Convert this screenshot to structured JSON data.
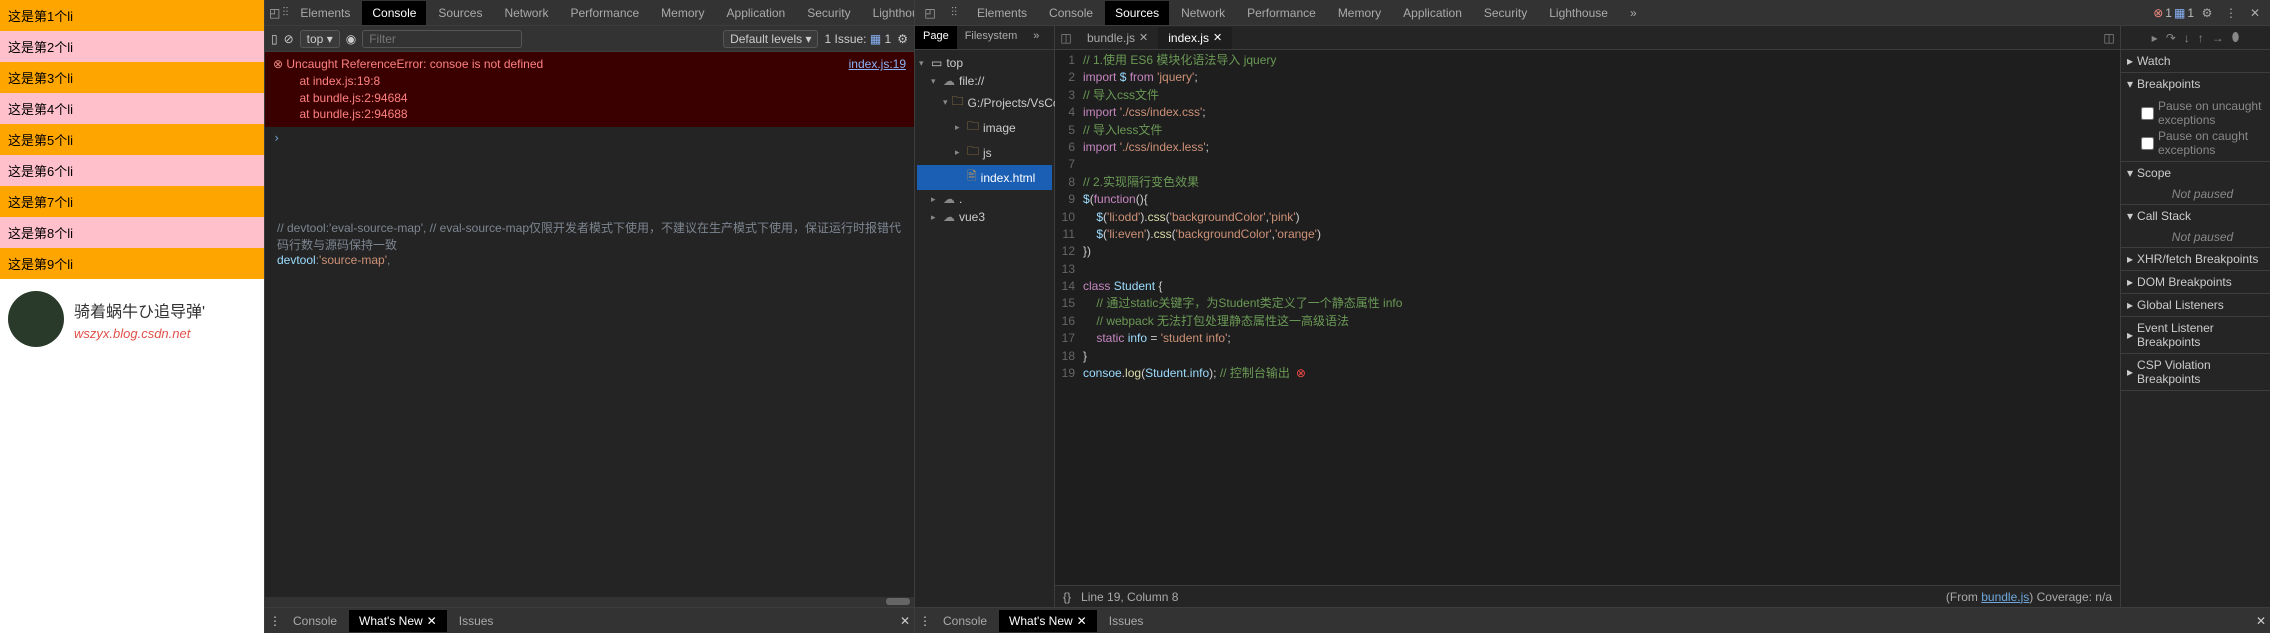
{
  "webpage": {
    "items": [
      "这是第1个li",
      "这是第2个li",
      "这是第3个li",
      "这是第4个li",
      "这是第5个li",
      "这是第6个li",
      "这是第7个li",
      "这是第8个li",
      "这是第9个li"
    ],
    "profile_name": "骑着蜗牛ひ追导弹'",
    "profile_url": "wszyx.blog.csdn.net"
  },
  "devtools_tabs": [
    "Elements",
    "Console",
    "Sources",
    "Network",
    "Performance",
    "Memory",
    "Application",
    "Security",
    "Lighthouse"
  ],
  "overflow": "»",
  "err_count": "1",
  "info_count": "1",
  "gear": "⚙",
  "console": {
    "top_context": "top",
    "eye": "◉",
    "filter_placeholder": "Filter",
    "levels": "Default levels",
    "issues": "1 Issue:",
    "error": {
      "msg": "Uncaught ReferenceError: consoe is not defined",
      "at1": "at index.js:19:8",
      "at2": "at bundle.js:2:94684",
      "at3": "at bundle.js:2:94688",
      "link": "index.js:19"
    },
    "code_comment": "// devtool:'eval-source-map', // eval-source-map仅限开发者模式下使用，不建议在生产模式下使用，保证运行时报错代码行数与源码保持一致",
    "code_line": "devtool:'source-map',"
  },
  "drawer": {
    "console": "Console",
    "whatsnew": "What's New",
    "issues": "Issues"
  },
  "sources": {
    "nav_tabs": {
      "page": "Page",
      "filesystem": "Filesystem"
    },
    "tree": {
      "top": "top",
      "file": "file://",
      "project": "G:/Projects/VsCodeProjec",
      "image": "image",
      "js": "js",
      "index_html": "index.html",
      "dot": ".",
      "vue3": "vue3"
    },
    "editor_tabs": {
      "bundle": "bundle.js",
      "index": "index.js"
    },
    "code_lines": [
      {
        "n": 1,
        "html": "<span class='c-com'>// 1.使用 ES6 模块化语法导入 jquery</span>"
      },
      {
        "n": 2,
        "html": "<span class='c-key'>import</span> <span class='c-id'>$</span> <span class='c-key'>from</span> <span class='c-str'>'jquery'</span>;"
      },
      {
        "n": 3,
        "html": "<span class='c-com'>// 导入css文件</span>"
      },
      {
        "n": 4,
        "html": "<span class='c-key'>import</span> <span class='c-str'>'./css/index.css'</span>;"
      },
      {
        "n": 5,
        "html": "<span class='c-com'>// 导入less文件</span>"
      },
      {
        "n": 6,
        "html": "<span class='c-key'>import</span> <span class='c-str'>'./css/index.less'</span>;"
      },
      {
        "n": 7,
        "html": ""
      },
      {
        "n": 8,
        "html": "<span class='c-com'>// 2.实现隔行变色效果</span>"
      },
      {
        "n": 9,
        "html": "<span class='c-id'>$</span>(<span class='c-key'>function</span>(){"
      },
      {
        "n": 10,
        "html": "    <span class='c-id'>$</span>(<span class='c-str'>'li:odd'</span>).<span class='c-fn'>css</span>(<span class='c-str'>'backgroundColor'</span>,<span class='c-str'>'pink'</span>)"
      },
      {
        "n": 11,
        "html": "    <span class='c-id'>$</span>(<span class='c-str'>'li:even'</span>).<span class='c-fn'>css</span>(<span class='c-str'>'backgroundColor'</span>,<span class='c-str'>'orange'</span>)"
      },
      {
        "n": 12,
        "html": "})"
      },
      {
        "n": 13,
        "html": ""
      },
      {
        "n": 14,
        "html": "<span class='c-key'>class</span> <span class='c-id'>Student</span> {"
      },
      {
        "n": 15,
        "html": "    <span class='c-com'>// 通过static关键字，为Student类定义了一个静态属性 info</span>"
      },
      {
        "n": 16,
        "html": "    <span class='c-com'>// webpack 无法打包处理静态属性这一高级语法</span>"
      },
      {
        "n": 17,
        "html": "    <span class='c-key'>static</span> <span class='c-id'>info</span> = <span class='c-str'>'student info'</span>;"
      },
      {
        "n": 18,
        "html": "}"
      },
      {
        "n": 19,
        "html": "<span class='c-id'>consoe</span>.<span class='c-fn'>log</span>(<span class='c-id'>Student</span>.<span class='c-id'>info</span>); <span class='c-com'>// 控制台输出</span><span class='err-dot'>⊗</span>"
      }
    ],
    "status": {
      "pos": "Line 19, Column 8",
      "from": "(From ",
      "bundle": "bundle.js",
      "cov": ") Coverage: n/a"
    }
  },
  "debug": {
    "watch": "Watch",
    "breakpoints": "Breakpoints",
    "bp1": "Pause on uncaught exceptions",
    "bp2": "Pause on caught exceptions",
    "scope": "Scope",
    "not_paused": "Not paused",
    "callstack": "Call Stack",
    "xhr": "XHR/fetch Breakpoints",
    "dom": "DOM Breakpoints",
    "gl": "Global Listeners",
    "ev": "Event Listener Breakpoints",
    "csp": "CSP Violation Breakpoints"
  }
}
